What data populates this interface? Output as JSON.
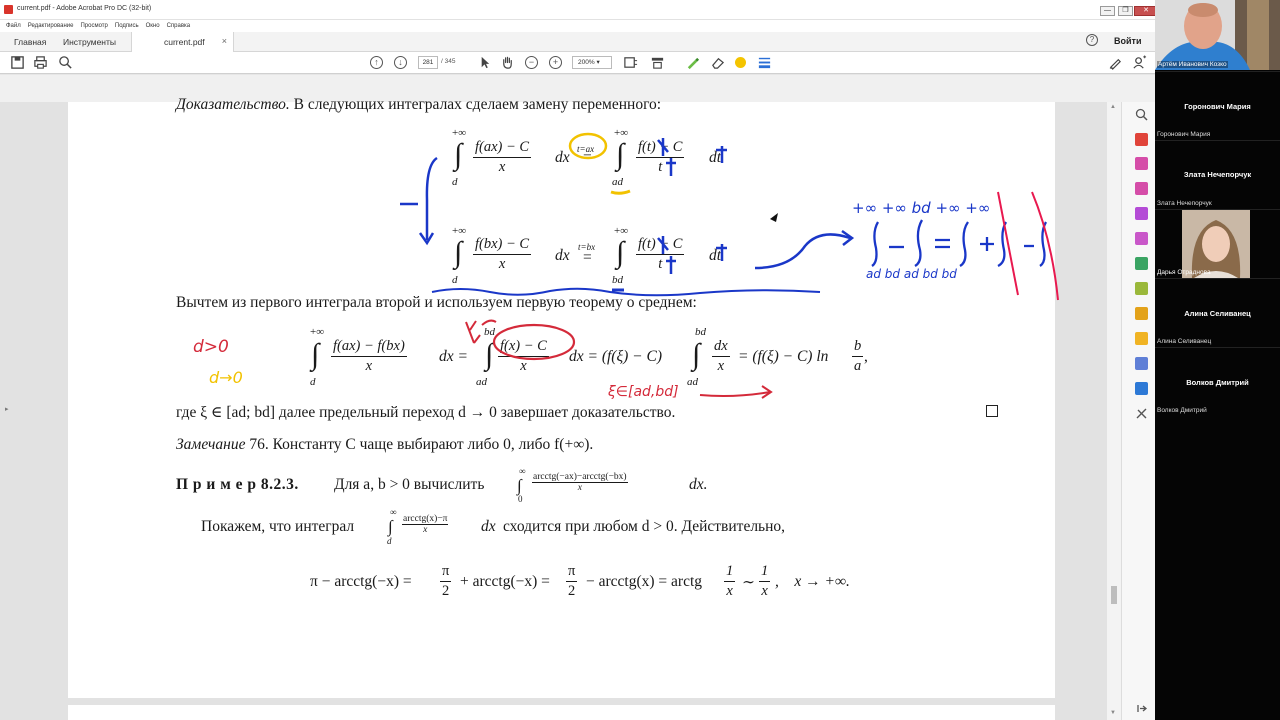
{
  "window": {
    "title": "current.pdf - Adobe Acrobat Pro DC (32-bit)",
    "buttons": [
      "—",
      "❐",
      "✕"
    ]
  },
  "menu": [
    "Файл",
    "Редактирование",
    "Просмотр",
    "Подпись",
    "Окно",
    "Справка"
  ],
  "tabs": {
    "home": "Главная",
    "tools": "Инструменты",
    "doc": "current.pdf",
    "close": "×"
  },
  "header": {
    "help": "?",
    "signin": "Войти"
  },
  "toolbar": {
    "page_current": "281",
    "page_total": "/ 345",
    "zoom": "200%",
    "zoom_arrow": "▾"
  },
  "document": {
    "proof_label": "Доказательство.",
    "proof_text": "В следующих интегралах сделаем замену переменного:",
    "eq1": {
      "upper": "+∞",
      "lower": "d",
      "num": "f(ax) − C",
      "den": "x",
      "dx": "dx",
      "subst": "t=ax",
      "eq": "=",
      "upper2": "+∞",
      "lower2": "ad",
      "num2": "f(t) − C",
      "den2": "t",
      "dt": "dt"
    },
    "eq2": {
      "upper": "+∞",
      "lower": "d",
      "num": "f(bx) − C",
      "den": "x",
      "dx": "dx",
      "subst": "t=bx",
      "eq": "=",
      "upper2": "+∞",
      "lower2": "bd",
      "num2": "f(t) − C",
      "den2": "t",
      "dt": "dt"
    },
    "subtract_text": "Вычтем из первого интеграла второй и используем первую теорему о среднем:",
    "eq3": {
      "upper": "+∞",
      "lower": "d",
      "num": "f(ax) − f(bx)",
      "den": "x",
      "dx": "dx =",
      "upper2": "bd",
      "lower2": "ad",
      "num2": "f(x) − C",
      "den2": "x",
      "mid": "dx = (f(ξ) − C)",
      "upper3": "bd",
      "lower3": "ad",
      "num3": "dx",
      "den3": "x",
      "tail": "= (f(ξ) − C) ln",
      "num4": "b",
      "den4": "a",
      "comma": ","
    },
    "where_text": "где ξ ∈ [ad; bd] далее предельный переход d → 0 завершает доказательство.",
    "remark_label": "Замечание",
    "remark_text": "76. Константу C чаще выбирают либо 0, либо f(+∞).",
    "example_label": "П р и м е р  8.2.3.",
    "example_text": "Для a, b > 0 вычислить",
    "example_int": {
      "upper": "∞",
      "lower": "0",
      "num": "arcctg(−ax)−arcctg(−bx)",
      "den": "x",
      "dx": "dx."
    },
    "show_text1": "Покажем, что интеграл",
    "show_int": {
      "upper": "∞",
      "lower": "d",
      "num": "arcctg(x)−π",
      "den": "x",
      "dx": "dx"
    },
    "show_text2": "сходится при любом d > 0. Действительно,",
    "eq4": {
      "p1": "π − arcctg(−x) =",
      "f1n": "π",
      "f1d": "2",
      "p2": "+ arcctg(−x) =",
      "f2n": "π",
      "f2d": "2",
      "p3": "− arcctg(x) = arctg",
      "f3n": "1",
      "f3d": "x",
      "p4": "∼",
      "f4n": "1",
      "f4d": "x",
      "p5": ",    x → +∞."
    }
  },
  "handwriting": {
    "d_pos": "d>0",
    "d_to_zero": "d→0",
    "xi_note": "ξ∈[ad,bd]",
    "blue_top": "+∞  +∞  bd  +∞ +∞",
    "blue_bottom": "ad   bd   ad   bd  bd"
  },
  "participants": [
    {
      "name": "Артём Иванович Козко",
      "video": true
    },
    {
      "name": "Горонович Мария",
      "video": false
    },
    {
      "name": "Злата Нечепорчук",
      "video": false
    },
    {
      "name": "Дарья Отраднова",
      "video": true
    },
    {
      "name": "Алина Селиванец",
      "video": false
    },
    {
      "name": "Волков Дмитрий",
      "video": false
    }
  ],
  "colors": {
    "annot_red": "#d42a3a",
    "annot_blue": "#1a37c8",
    "annot_yellow": "#f2c200",
    "annot_pink": "#e8194f"
  }
}
